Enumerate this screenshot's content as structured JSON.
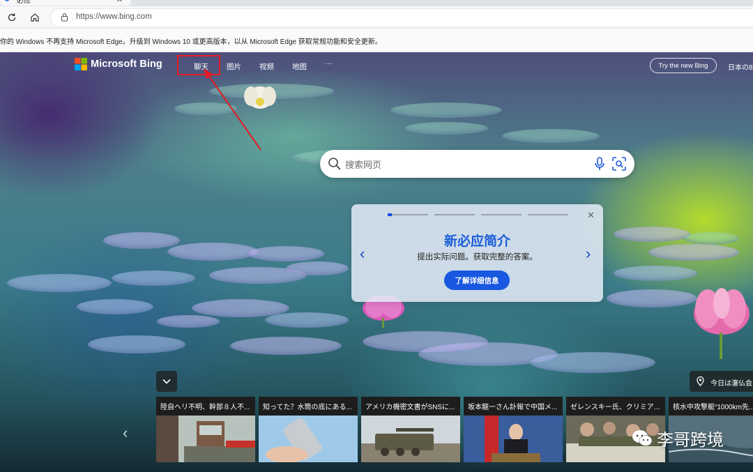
{
  "browser": {
    "tab_title": "必应",
    "url": "https://www.bing.com",
    "info_message": "你的 Windows 不再支持 Microsoft Edge。升级到 Windows 10 或更高版本，以从 Microsoft Edge 获取常规功能和安全更新。"
  },
  "bing": {
    "logo_text": "Microsoft Bing",
    "nav": [
      "聊天",
      "图片",
      "视频",
      "地图",
      "···"
    ],
    "try_button": "Try the new Bing",
    "language_link": "日本の8"
  },
  "search": {
    "placeholder": "搜索网页"
  },
  "promo": {
    "title": "新必应简介",
    "subtitle": "提出实际问题。获取完整的答案。",
    "button": "了解详细信息",
    "prev": "‹",
    "next": "›",
    "close": "✕",
    "slide_count": 4,
    "active_slide": 1
  },
  "location": {
    "text": "今日は瀋仏会"
  },
  "news": [
    {
      "headline": "陸自ヘリ不明、幹部８人不..."
    },
    {
      "headline": "知ってた？水筒の底にある..."
    },
    {
      "headline": "アメリカ機密文書がSNSに..."
    },
    {
      "headline": "坂本龍一さん訃報で中国メ..."
    },
    {
      "headline": "ゼレンスキー氏、クリミア..."
    },
    {
      "headline": "核水中攻撃艇“1000km先..."
    }
  ],
  "watermark": {
    "text": "李哥跨境"
  },
  "colors": {
    "accent": "#1858e0",
    "annotation": "#e31b23",
    "promo_title": "#1a5bd9"
  }
}
